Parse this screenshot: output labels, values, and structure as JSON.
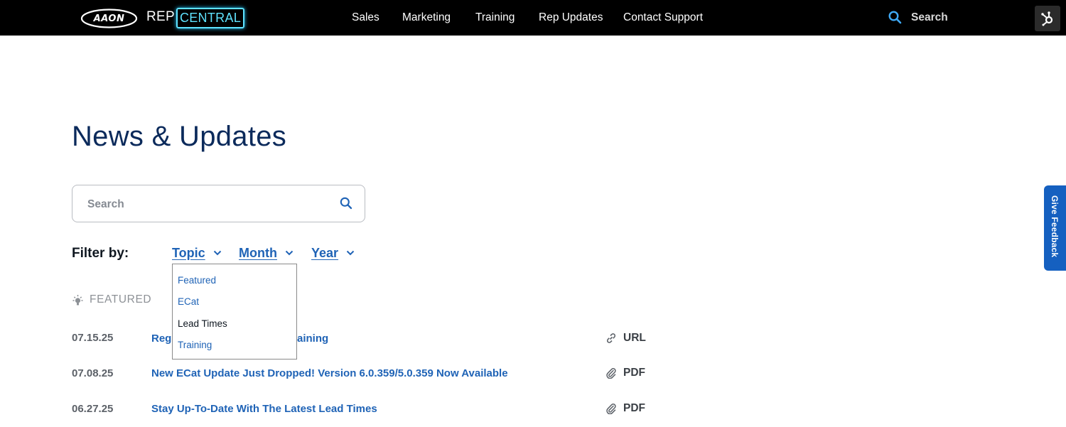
{
  "header": {
    "logo_text": "AAON",
    "brand_rep": "REP",
    "brand_central": "CENTRAL",
    "nav": [
      "Sales",
      "Marketing",
      "Training",
      "Rep Updates",
      "Contact Support"
    ],
    "search_label": "Search",
    "icons": {
      "search": "search-icon",
      "hub": "hubspot-icon"
    }
  },
  "page": {
    "title": "News & Updates",
    "search_placeholder": "Search",
    "filter_label": "Filter by:",
    "filters": [
      "Topic",
      "Month",
      "Year"
    ],
    "topic_dropdown": [
      "Featured",
      "ECat",
      "Lead Times",
      "Training"
    ],
    "topic_dropdown_active": "Lead Times",
    "featured_label": "FEATURED",
    "rows": [
      {
        "date": "07.15.25",
        "title_left": "Reg",
        "title_right": "aining",
        "type": "URL",
        "icon": "link-icon"
      },
      {
        "date": "07.08.25",
        "title": "New ECat Update Just Dropped! Version 6.0.359/5.0.359 Now Available",
        "type": "PDF",
        "icon": "paperclip-icon"
      },
      {
        "date": "06.27.25",
        "title": "Stay Up-To-Date With The Latest Lead Times",
        "type": "PDF",
        "icon": "paperclip-icon"
      }
    ]
  },
  "feedback": {
    "label": "Give Feedback"
  },
  "colors": {
    "accent": "#1f63b6",
    "title": "#0b2a5b",
    "central": "#5fe3ff",
    "header_bg": "#000000",
    "feedback_bg": "#1560c0"
  }
}
